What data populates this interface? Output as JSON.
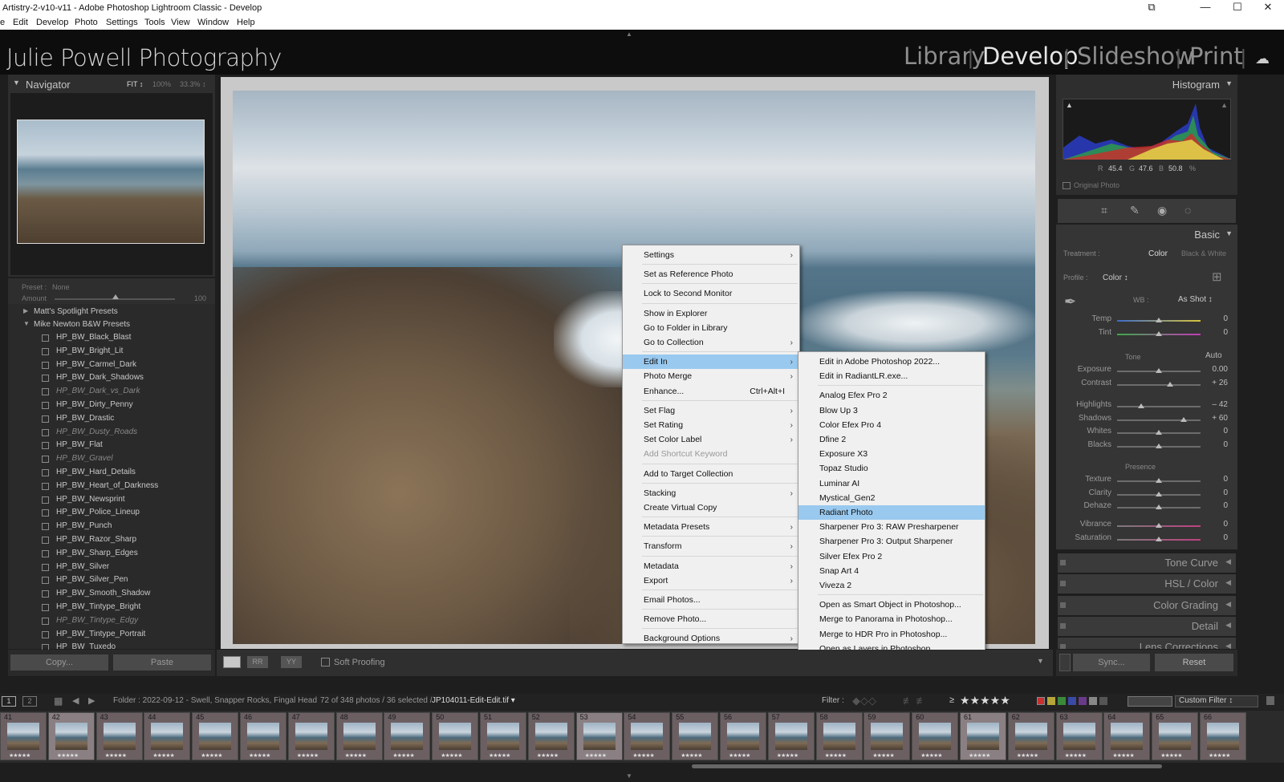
{
  "window": {
    "title": "Artistry-2-v10-v11 - Adobe Photoshop Lightroom Classic - Develop",
    "controls": [
      "⧉",
      "—",
      "☐",
      "✕"
    ]
  },
  "menubar": [
    "e",
    "Edit",
    "Develop",
    "Photo",
    "Settings",
    "Tools",
    "View",
    "Window",
    "Help"
  ],
  "identity": {
    "plate": "Julie Powell Photography",
    "modules": [
      "Library",
      "Develop",
      "Slideshow",
      "Print"
    ],
    "active": "Develop"
  },
  "navigator": {
    "title": "Navigator",
    "fit": "FIT ↕",
    "z1": "100%",
    "z2": "33.3% ↕"
  },
  "presets": {
    "preset_label": "Preset :",
    "preset_value": "None",
    "amount_label": "Amount",
    "amount_value": "100",
    "groups": [
      "Matt's Spotlight Presets",
      "Mike Newton B&W Presets"
    ],
    "items": [
      {
        "name": "HP_BW_Black_Blast",
        "dim": false
      },
      {
        "name": "HP_BW_Bright_Lit",
        "dim": false
      },
      {
        "name": "HP_BW_Carmel_Dark",
        "dim": false
      },
      {
        "name": "HP_BW_Dark_Shadows",
        "dim": false
      },
      {
        "name": "HP_BW_Dark_vs_Dark",
        "dim": true
      },
      {
        "name": "HP_BW_Dirty_Penny",
        "dim": false
      },
      {
        "name": "HP_BW_Drastic",
        "dim": false
      },
      {
        "name": "HP_BW_Dusty_Roads",
        "dim": true
      },
      {
        "name": "HP_BW_Flat",
        "dim": false
      },
      {
        "name": "HP_BW_Gravel",
        "dim": true
      },
      {
        "name": "HP_BW_Hard_Details",
        "dim": false
      },
      {
        "name": "HP_BW_Heart_of_Darkness",
        "dim": false
      },
      {
        "name": "HP_BW_Newsprint",
        "dim": false
      },
      {
        "name": "HP_BW_Police_Lineup",
        "dim": false
      },
      {
        "name": "HP_BW_Punch",
        "dim": false
      },
      {
        "name": "HP_BW_Razor_Sharp",
        "dim": false
      },
      {
        "name": "HP_BW_Sharp_Edges",
        "dim": false
      },
      {
        "name": "HP_BW_Silver",
        "dim": false
      },
      {
        "name": "HP_BW_Silver_Pen",
        "dim": false
      },
      {
        "name": "HP_BW_Smooth_Shadow",
        "dim": false
      },
      {
        "name": "HP_BW_Tintype_Bright",
        "dim": false
      },
      {
        "name": "HP_BW_Tintype_Edgy",
        "dim": true
      },
      {
        "name": "HP_BW_Tintype_Portrait",
        "dim": false
      },
      {
        "name": "HP_BW_Tuxedo",
        "dim": false
      }
    ]
  },
  "left_buttons": {
    "copy": "Copy...",
    "paste": "Paste"
  },
  "toolbar": {
    "soft_proofing": "Soft Proofing",
    "loupe_icon": "▭",
    "compare_icon": "RR",
    "survey_icon": "YY"
  },
  "context_menu": {
    "items": [
      {
        "label": "Settings",
        "arrow": true
      },
      {
        "sep": true
      },
      {
        "label": "Set as Reference Photo"
      },
      {
        "sep": true
      },
      {
        "label": "Lock to Second Monitor"
      },
      {
        "sep": true
      },
      {
        "label": "Show in Explorer"
      },
      {
        "label": "Go to Folder in Library"
      },
      {
        "label": "Go to Collection",
        "arrow": true
      },
      {
        "sep": true
      },
      {
        "label": "Edit In",
        "arrow": true,
        "hl": true
      },
      {
        "label": "Photo Merge",
        "arrow": true
      },
      {
        "label": "Enhance...",
        "shortcut": "Ctrl+Alt+I"
      },
      {
        "sep": true
      },
      {
        "label": "Set Flag",
        "arrow": true
      },
      {
        "label": "Set Rating",
        "arrow": true
      },
      {
        "label": "Set Color Label",
        "arrow": true
      },
      {
        "label": "Add Shortcut Keyword",
        "dis": true
      },
      {
        "sep": true
      },
      {
        "label": "Add to Target Collection"
      },
      {
        "sep": true
      },
      {
        "label": "Stacking",
        "arrow": true
      },
      {
        "label": "Create Virtual Copy"
      },
      {
        "sep": true
      },
      {
        "label": "Metadata Presets",
        "arrow": true
      },
      {
        "sep": true
      },
      {
        "label": "Transform",
        "arrow": true
      },
      {
        "sep": true
      },
      {
        "label": "Metadata",
        "arrow": true
      },
      {
        "label": "Export",
        "arrow": true
      },
      {
        "sep": true
      },
      {
        "label": "Email Photos..."
      },
      {
        "sep": true
      },
      {
        "label": "Remove Photo..."
      },
      {
        "sep": true
      },
      {
        "label": "Background Options",
        "arrow": true
      }
    ]
  },
  "submenu": {
    "items": [
      {
        "label": "Edit in Adobe Photoshop 2022..."
      },
      {
        "label": "Edit in RadiantLR.exe..."
      },
      {
        "sep": true
      },
      {
        "label": "Analog Efex Pro 2"
      },
      {
        "label": "Blow Up 3"
      },
      {
        "label": "Color Efex Pro 4"
      },
      {
        "label": "Dfine 2"
      },
      {
        "label": "Exposure X3"
      },
      {
        "label": "Topaz Studio"
      },
      {
        "label": "Luminar AI"
      },
      {
        "label": "Mystical_Gen2"
      },
      {
        "label": "Radiant Photo",
        "hl": true
      },
      {
        "label": "Sharpener Pro 3: RAW Presharpener"
      },
      {
        "label": "Sharpener Pro 3: Output Sharpener"
      },
      {
        "label": "Silver Efex Pro 2"
      },
      {
        "label": "Snap Art 4"
      },
      {
        "label": "Viveza 2"
      },
      {
        "sep": true
      },
      {
        "label": "Open as Smart Object in Photoshop..."
      },
      {
        "label": "Merge to Panorama in Photoshop..."
      },
      {
        "label": "Merge to HDR Pro in Photoshop..."
      },
      {
        "label": "Open as Layers in Photoshop..."
      }
    ]
  },
  "histogram": {
    "title": "Histogram",
    "r_label": "R",
    "r": "45.4",
    "g_label": "G",
    "g": "47.6",
    "b_label": "B",
    "b": "50.8",
    "pct": "%",
    "original": "Original Photo"
  },
  "basic": {
    "title": "Basic",
    "treatment_label": "Treatment :",
    "color": "Color",
    "bw": "Black & White",
    "profile_label": "Profile :",
    "profile_value": "Color ↕",
    "wb_label": "WB :",
    "wb_value": "As Shot ↕",
    "tone_label": "Tone",
    "auto": "Auto",
    "presence_label": "Presence",
    "sliders": [
      {
        "name": "Temp",
        "value": "0",
        "pos": 0.5
      },
      {
        "name": "Tint",
        "value": "0",
        "pos": 0.5
      },
      {
        "name": "Exposure",
        "value": "0.00",
        "pos": 0.5
      },
      {
        "name": "Contrast",
        "value": "+ 26",
        "pos": 0.63
      },
      {
        "name": "Highlights",
        "value": "– 42",
        "pos": 0.29
      },
      {
        "name": "Shadows",
        "value": "+ 60",
        "pos": 0.8
      },
      {
        "name": "Whites",
        "value": "0",
        "pos": 0.5
      },
      {
        "name": "Blacks",
        "value": "0",
        "pos": 0.5
      },
      {
        "name": "Texture",
        "value": "0",
        "pos": 0.5
      },
      {
        "name": "Clarity",
        "value": "0",
        "pos": 0.5
      },
      {
        "name": "Dehaze",
        "value": "0",
        "pos": 0.5
      },
      {
        "name": "Vibrance",
        "value": "0",
        "pos": 0.5
      },
      {
        "name": "Saturation",
        "value": "0",
        "pos": 0.5
      }
    ]
  },
  "collapsed_panels": [
    {
      "name": "Tone Curve"
    },
    {
      "name": "HSL / Color"
    },
    {
      "name": "Color Grading"
    },
    {
      "name": "Detail"
    },
    {
      "name": "Lens Corrections"
    }
  ],
  "right_buttons": {
    "sync": "Sync...",
    "reset": "Reset"
  },
  "filmstrip_bar": {
    "screen1": "1",
    "screen2": "2",
    "folder": "Folder : 2022-09-12 - Swell, Snapper Rocks, Fingal Head",
    "count": "72 of 348 photos / 36 selected /",
    "file": "JP104011-Edit-Edit.tif ▾",
    "filter_label": "Filter :",
    "rating_op": "≥",
    "stars": "★★★★★",
    "custom_filter": "Custom Filter ↕"
  },
  "thumbnails": [
    {
      "n": "41"
    },
    {
      "n": "42"
    },
    {
      "n": "43"
    },
    {
      "n": "44"
    },
    {
      "n": "45"
    },
    {
      "n": "46"
    },
    {
      "n": "47"
    },
    {
      "n": "48"
    },
    {
      "n": "49"
    },
    {
      "n": "50"
    },
    {
      "n": "51"
    },
    {
      "n": "52"
    },
    {
      "n": "53"
    },
    {
      "n": "54"
    },
    {
      "n": "55"
    },
    {
      "n": "56"
    },
    {
      "n": "57"
    },
    {
      "n": "58"
    },
    {
      "n": "59"
    },
    {
      "n": "60"
    },
    {
      "n": "61"
    },
    {
      "n": "62"
    },
    {
      "n": "63"
    },
    {
      "n": "64"
    },
    {
      "n": "65"
    },
    {
      "n": "66"
    }
  ],
  "colors": {
    "highlight": "#99c9ef",
    "panel": "#353535",
    "identity": "#0d0d0d"
  }
}
